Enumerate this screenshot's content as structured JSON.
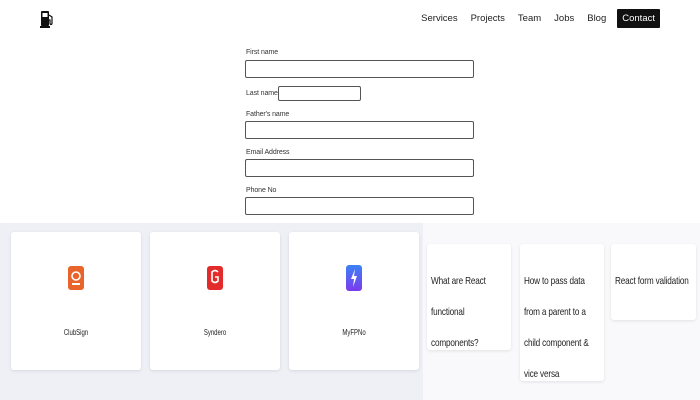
{
  "header": {
    "logo_icon": "fuel-pump-icon",
    "nav": [
      {
        "label": "Services"
      },
      {
        "label": "Projects"
      },
      {
        "label": "Team"
      },
      {
        "label": "Jobs"
      },
      {
        "label": "Blog"
      },
      {
        "label": "Contact"
      }
    ]
  },
  "form": {
    "first_name": {
      "label": "First name",
      "value": ""
    },
    "last_name": {
      "label": "Last name",
      "value": ""
    },
    "father_name": {
      "label": "Father's name",
      "value": ""
    },
    "email": {
      "label": "Email Address",
      "value": ""
    },
    "phone": {
      "label": "Phone No",
      "value": ""
    }
  },
  "projects": [
    {
      "name": "ClubSign",
      "icon": "clubsign-app-icon",
      "color": "#e8642a"
    },
    {
      "name": "Syndero",
      "icon": "syndero-app-icon",
      "color": "#e32b2b"
    },
    {
      "name": "MyFPNo",
      "icon": "myfpno-app-icon",
      "color": "#4a5cf0"
    }
  ],
  "blog": [
    {
      "title": "What are React functional components?"
    },
    {
      "title": "How to pass data from a parent to a child component & vice versa"
    },
    {
      "title": "React form validation"
    }
  ],
  "colors": {
    "band_bg": "#eef0f6",
    "contact_bg": "#111111"
  }
}
